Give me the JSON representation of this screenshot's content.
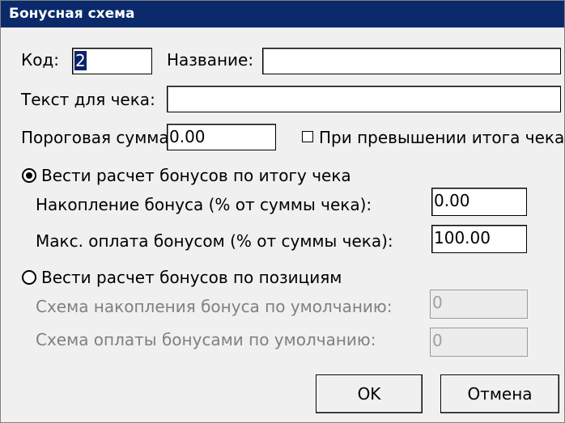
{
  "window": {
    "title": "Бонусная схема"
  },
  "fields": {
    "code_label": "Код:",
    "code_value": "2",
    "name_label": "Название:",
    "name_value": "",
    "receipt_text_label": "Текст для чека:",
    "receipt_text_value": "",
    "threshold_label": "Пороговая сумма:",
    "threshold_value": "0.00",
    "exceed_checkbox_label": "При превышении итога чека",
    "exceed_checkbox_checked": false
  },
  "mode_total": {
    "radio_label": "Вести расчет бонусов по итогу чека",
    "selected": true,
    "accrual_label": "Накопление бонуса (% от суммы чека):",
    "accrual_value": "0.00",
    "max_payment_label": "Макс. оплата бонусом (% от суммы чека):",
    "max_payment_value": "100.00"
  },
  "mode_positions": {
    "radio_label": "Вести расчет бонусов по позициям",
    "selected": false,
    "default_accrual_label": "Схема накопления бонуса по умолчанию:",
    "default_accrual_value": "0",
    "default_payment_label": "Схема оплаты бонусами по умолчанию:",
    "default_payment_value": "0"
  },
  "buttons": {
    "ok": "OK",
    "cancel": "Отмена"
  }
}
